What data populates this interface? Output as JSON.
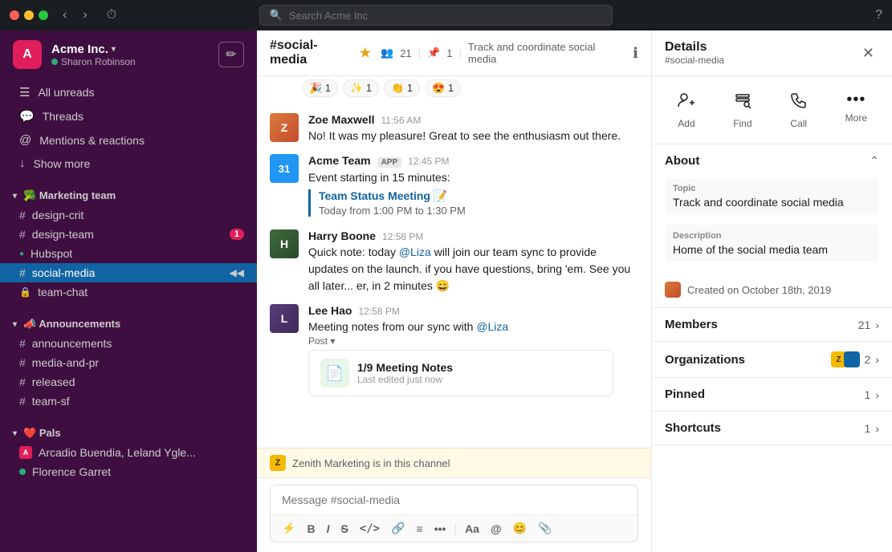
{
  "titlebar": {
    "search_placeholder": "Search Acme Inc"
  },
  "sidebar": {
    "workspace_name": "Acme Inc.",
    "workspace_name_suffix": " ▾",
    "user_name": "Sharon Robinson",
    "all_unreads": "All unreads",
    "threads": "Threads",
    "mentions_reactions": "Mentions & reactions",
    "show_more": "Show more",
    "marketing_team_label": "🥦 Marketing team",
    "announcements_label": "📣 Announcements",
    "pals_label": "❤️ Pals",
    "channels": {
      "marketing": [
        "design-crit",
        "design-team",
        "Hubspot",
        "social-media",
        "team-chat"
      ],
      "design_team_badge": "1",
      "announcements": [
        "announcements",
        "media-and-pr",
        "released",
        "team-sf"
      ]
    },
    "dms": [
      "Arcadio Buendia, Leland Ygle...",
      "Florence Garret"
    ]
  },
  "chat": {
    "channel_name": "#social-media",
    "channel_members": "21",
    "channel_pins": "1",
    "channel_topic": "Track and coordinate social media",
    "reactions": [
      {
        "emoji": "🎉",
        "count": "1"
      },
      {
        "emoji": "✨",
        "count": "1"
      },
      {
        "emoji": "👏",
        "count": "1"
      },
      {
        "emoji": "😍",
        "count": "1"
      }
    ],
    "messages": [
      {
        "id": "zoe",
        "sender": "Zoe Maxwell",
        "time": "11:56 AM",
        "text": "No! It was my pleasure! Great to see the enthusiasm out there."
      },
      {
        "id": "acme",
        "sender": "Acme Team",
        "app": true,
        "time": "12:45 PM",
        "text": "Event starting in 15 minutes:",
        "link_text": "Team Status Meeting 📝",
        "link_sub": "Today from 1:00 PM to 1:30 PM"
      },
      {
        "id": "harry",
        "sender": "Harry Boone",
        "time": "12:58 PM",
        "text": "Quick note: today @Liza will join our team sync to provide updates on the launch. if you have questions, bring 'em. See you all later... er, in 2 minutes 😄"
      },
      {
        "id": "lee",
        "sender": "Lee Hao",
        "time": "12:58 PM",
        "text": "Meeting notes from our sync with @Liza",
        "post_label": "Post ▾",
        "attachment_title": "1/9 Meeting Notes",
        "attachment_sub": "Last edited just now"
      }
    ],
    "notification": "Zenith Marketing is in this channel",
    "input_placeholder": "Message #social-media",
    "toolbar_items": [
      "⚡",
      "B",
      "I",
      "S̶",
      "</>",
      "🔗",
      "≡",
      "•••",
      "Aa",
      "@",
      "😊",
      "📎"
    ]
  },
  "details": {
    "title": "Details",
    "subtitle": "#social-media",
    "actions": [
      {
        "icon": "👤+",
        "label": "Add"
      },
      {
        "icon": "🔍≡",
        "label": "Find"
      },
      {
        "icon": "📞",
        "label": "Call"
      },
      {
        "icon": "•••",
        "label": "More"
      }
    ],
    "about_title": "About",
    "topic_label": "Topic",
    "topic_value": "Track and coordinate social media",
    "description_label": "Description",
    "description_value": "Home of the social media team",
    "created_text": "Created on October 18th, 2019",
    "members_label": "Members",
    "members_count": "21",
    "organizations_label": "Organizations",
    "organizations_count": "2",
    "pinned_label": "Pinned",
    "pinned_count": "1",
    "shortcuts_label": "Shortcuts",
    "shortcuts_count": "1"
  }
}
